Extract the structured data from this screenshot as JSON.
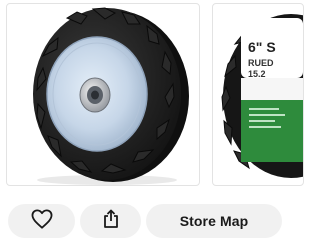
{
  "carousel": {
    "images": [
      {
        "alt": "",
        "icon": "wheel-product-image"
      },
      {
        "alt": "",
        "icon": "wheel-package-image",
        "package_text": [
          "6\" S",
          "RUED",
          "15.2"
        ]
      }
    ]
  },
  "actions": {
    "favorite": {
      "icon": "heart-outline-icon"
    },
    "share": {
      "icon": "share-icon"
    },
    "store_map": {
      "label": "Store Map"
    }
  },
  "colors": {
    "pill_background": "#f1f1f1",
    "text": "#1a1a1a",
    "hub": "#c6d6e8",
    "tire": "#1c1c1c",
    "package_green": "#2e8b3c"
  }
}
